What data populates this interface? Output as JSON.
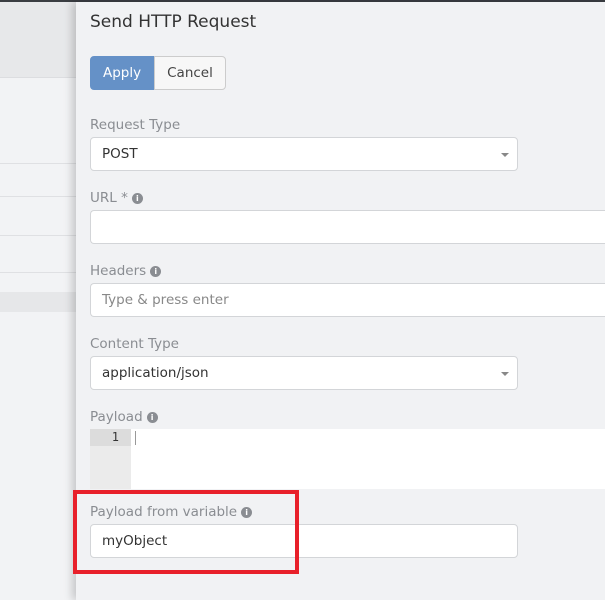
{
  "panel": {
    "title": "Send HTTP Request",
    "apply_label": "Apply",
    "cancel_label": "Cancel",
    "request_type": {
      "label": "Request Type",
      "value": "POST"
    },
    "url": {
      "label": "URL *",
      "value": ""
    },
    "headers": {
      "label": "Headers",
      "placeholder": "Type & press enter"
    },
    "content_type": {
      "label": "Content Type",
      "value": "application/json"
    },
    "payload": {
      "label": "Payload",
      "line_number": "1"
    },
    "payload_from_variable": {
      "label": "Payload from variable",
      "value": "myObject"
    }
  },
  "colors": {
    "accent": "#6591c7",
    "highlight": "#e8202a"
  }
}
